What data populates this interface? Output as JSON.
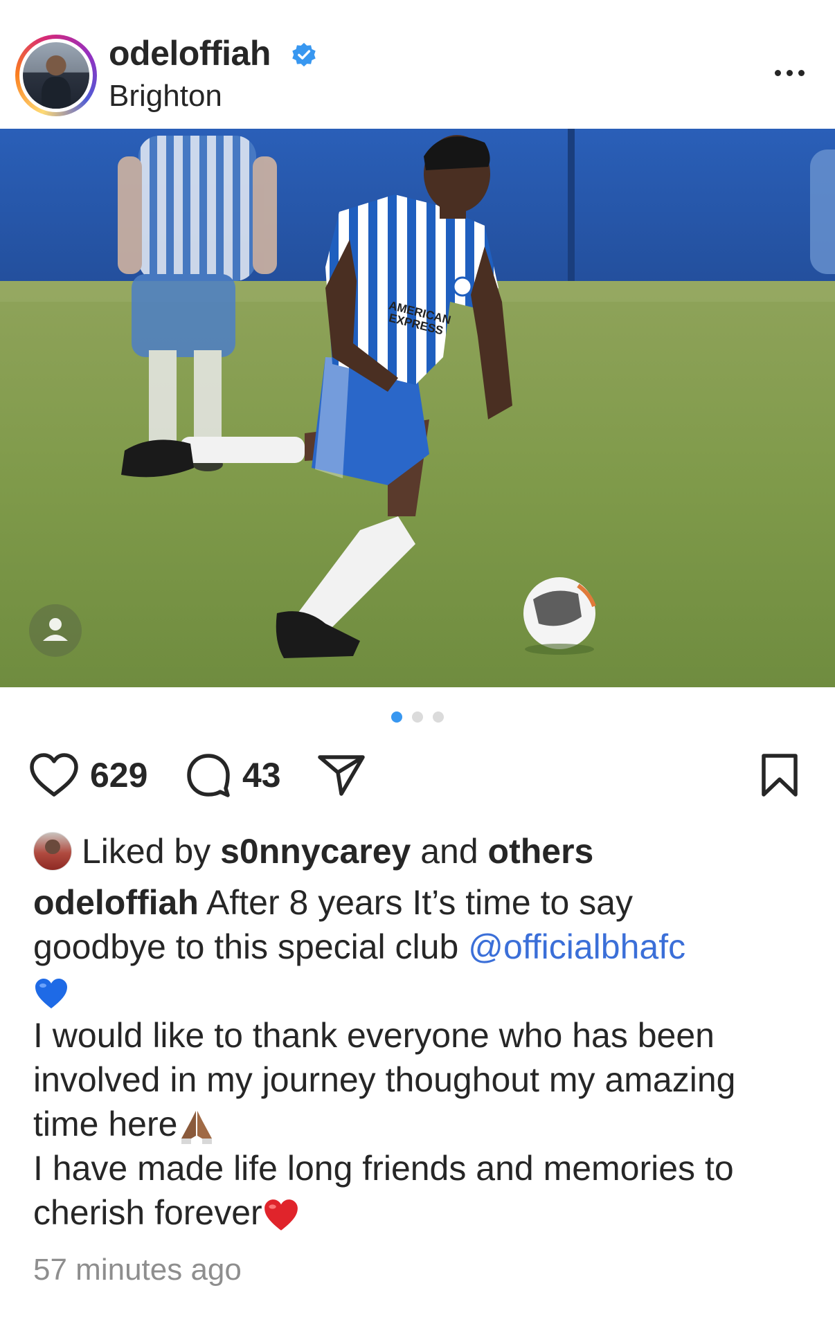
{
  "header": {
    "username": "odeloffiah",
    "location": "Brighton",
    "verified_icon": "verified-badge-icon",
    "more_icon": "more-horizontal-icon"
  },
  "photo": {
    "kit_text_1": "AMERICAN",
    "kit_text_2": "EXPRESS",
    "tag_icon": "user-tag-icon"
  },
  "carousel": {
    "pages": 3,
    "active": 1
  },
  "actions": {
    "like_count": "629",
    "comment_count": "43",
    "icons": [
      "heart-icon",
      "comment-icon",
      "share-icon",
      "bookmark-icon"
    ]
  },
  "likes": {
    "prefix": "Liked by ",
    "user": "s0nnycarey",
    "middle": " and ",
    "others": "others"
  },
  "caption": {
    "username": "odeloffiah",
    "line1_text": " After 8 years It’s time to say",
    "line2_text": "goodbye to this special club ",
    "mention": "@officialbhafc",
    "line3_emoji": "blue-heart-emoji",
    "line4": "I would like to thank everyone who has been",
    "line5": "involved in my journey thoughout my amazing",
    "line6_text": "time here",
    "line6_emoji": "folded-hands-emoji",
    "line7": "I have made life long friends and memories to",
    "line8_text": "cherish forever",
    "line8_emoji": "red-heart-emoji"
  },
  "timestamp": "57 minutes ago",
  "colors": {
    "text": "#262626",
    "muted": "#8e8e8e",
    "mention": "#3b6fd8",
    "verified": "#3897f0",
    "dot_active": "#3897f0",
    "dot_inactive": "#dbdbdb"
  }
}
